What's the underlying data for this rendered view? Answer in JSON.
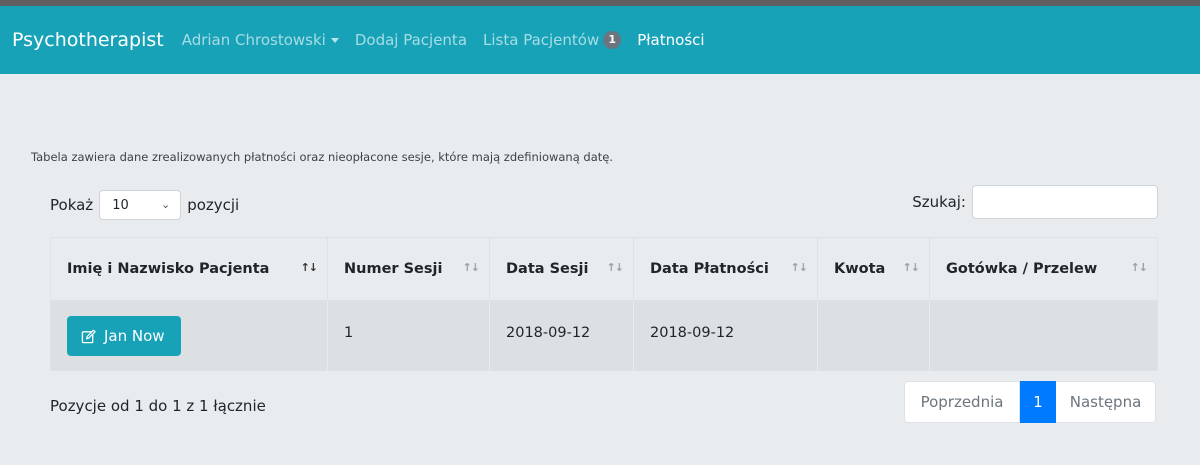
{
  "navbar": {
    "brand": "Psychotherapist",
    "user": "Adrian Chrostowski",
    "add_patient": "Dodaj Pacjenta",
    "patient_list": "Lista Pacjentów",
    "patient_list_badge": "1",
    "payments": "Płatności"
  },
  "description": "Tabela zawiera dane zrealizowanych płatności oraz nieopłacone sesje, które mają zdefiniowaną datę.",
  "length_menu": {
    "prefix": "Pokaż",
    "selected": "10",
    "suffix": "pozycji"
  },
  "search": {
    "label": "Szukaj:",
    "value": ""
  },
  "table": {
    "columns": [
      "Imię i Nazwisko Pacjenta",
      "Numer Sesji",
      "Data Sesji",
      "Data Płatności",
      "Kwota",
      "Gotówka / Przelew"
    ],
    "rows": [
      {
        "patient": "Jan Now",
        "session_number": "1",
        "session_date": "2018-09-12",
        "payment_date": "2018-09-12",
        "amount": "",
        "method": ""
      }
    ]
  },
  "info": "Pozycje od 1 do 1 z 1 łącznie",
  "pagination": {
    "previous": "Poprzednia",
    "current": "1",
    "next": "Następna"
  },
  "colors": {
    "navbar": "#17a2b8",
    "background": "#e9ecef",
    "page_active": "#007bff"
  }
}
